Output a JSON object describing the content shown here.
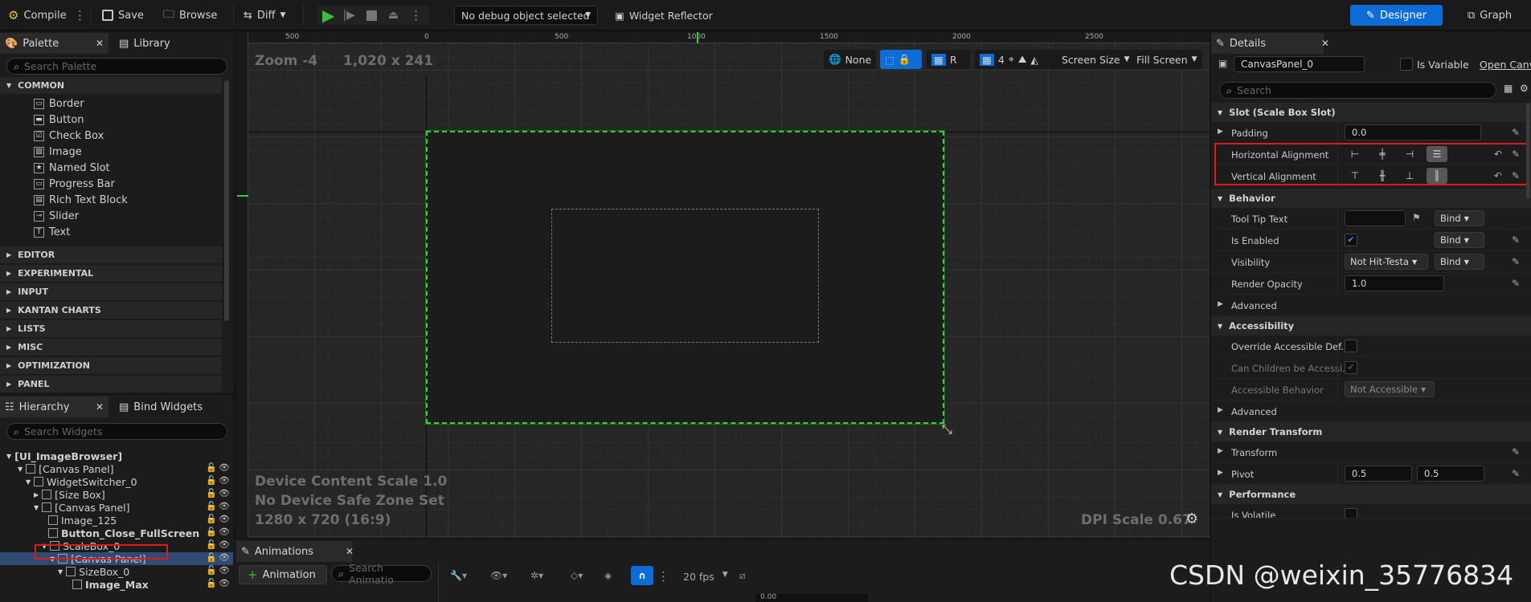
{
  "toolbar": {
    "compile": "Compile",
    "save": "Save",
    "browse": "Browse",
    "diff": "Diff",
    "debug_object": "No debug object selected",
    "widget_reflector": "Widget Reflector",
    "designer": "Designer",
    "graph": "Graph"
  },
  "palette": {
    "tab": "Palette",
    "library_tab": "Library",
    "search_placeholder": "Search Palette",
    "common_label": "COMMON",
    "items": [
      "Border",
      "Button",
      "Check Box",
      "Image",
      "Named Slot",
      "Progress Bar",
      "Rich Text Block",
      "Slider",
      "Text"
    ],
    "categories": [
      "EDITOR",
      "EXPERIMENTAL",
      "INPUT",
      "KANTAN CHARTS",
      "LISTS",
      "MISC",
      "OPTIMIZATION",
      "PANEL"
    ]
  },
  "hierarchy": {
    "tab": "Hierarchy",
    "bind_tab": "Bind Widgets",
    "search_placeholder": "Search Widgets",
    "rows": [
      "[UI_ImageBrowser]",
      "[Canvas Panel]",
      "WidgetSwitcher_0",
      "[Size Box]",
      "[Canvas Panel]",
      "Image_125",
      "Button_Close_FullScreen",
      "ScaleBox_0",
      "[Canvas Panel]",
      "SizeBox_0",
      "Image_Max"
    ]
  },
  "viewport": {
    "zoom": "Zoom -4",
    "resolution": "1,020 x 241",
    "none_label": "None",
    "r_label": "R",
    "grid_count": "4",
    "screen_size": "Screen Size",
    "fill_screen": "Fill Screen",
    "device_scale": "Device Content Scale 1.0",
    "safe_zone": "No Device Safe Zone Set",
    "res_label": "1280 x 720 (16:9)",
    "dpi": "DPI Scale 0.67",
    "ruler_h": [
      "500",
      "0",
      "500",
      "1000",
      "1500",
      "2000",
      "2500"
    ]
  },
  "animations": {
    "tab": "Animations",
    "add_button": "Animation",
    "search_placeholder": "Search Animatio",
    "fps": "20 fps",
    "time": "0.00"
  },
  "details": {
    "tab": "Details",
    "name": "CanvasPanel_0",
    "is_variable": "Is Variable",
    "open_canvas": "Open Canva",
    "search_placeholder": "Search",
    "sections": {
      "slot": "Slot (Scale Box Slot)",
      "behavior": "Behavior",
      "accessibility": "Accessibility",
      "render_transform": "Render Transform",
      "performance": "Performance"
    },
    "padding": "Padding",
    "padding_value": "0.0",
    "h_align": "Horizontal Alignment",
    "v_align": "Vertical Alignment",
    "tooltip": "Tool Tip Text",
    "bind": "Bind",
    "is_enabled": "Is Enabled",
    "visibility": "Visibility",
    "visibility_value": "Not Hit-Testa",
    "render_opacity": "Render Opacity",
    "render_opacity_value": "1.0",
    "advanced": "Advanced",
    "override_accessible": "Override Accessible Def...",
    "can_children": "Can Children be Accessi...",
    "accessible_behavior": "Accessible Behavior",
    "accessible_behavior_value": "Not Accessible",
    "transform": "Transform",
    "pivot": "Pivot",
    "pivot_x": "0.5",
    "pivot_y": "0.5",
    "is_volatile": "Is Volatile"
  },
  "watermark": "CSDN @weixin_35776834",
  "colors": {
    "accent": "#0d6dd8",
    "selection_green": "#2bd92b",
    "highlight_red": "#e01919"
  }
}
